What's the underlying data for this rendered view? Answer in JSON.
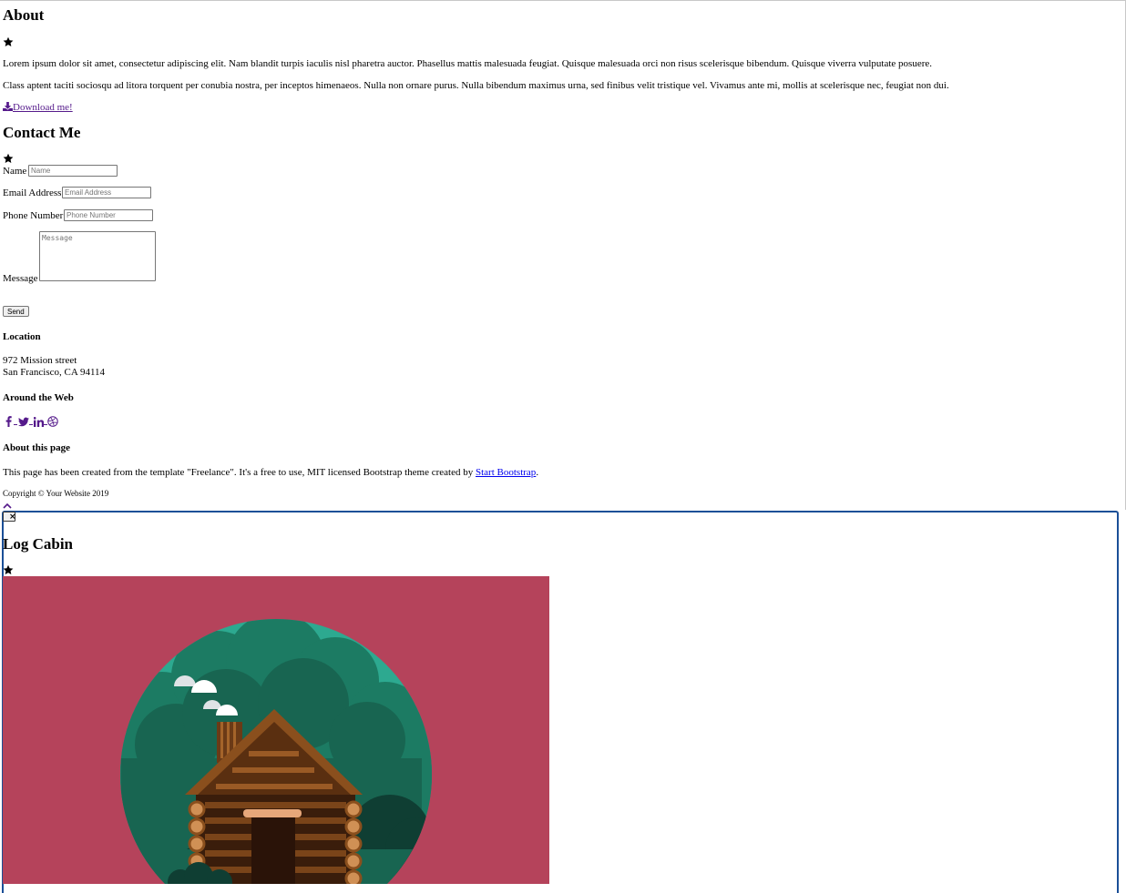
{
  "about": {
    "title": "About",
    "paragraph1": "Lorem ipsum dolor sit amet, consectetur adipiscing elit. Nam blandit turpis iaculis nisl pharetra auctor. Phasellus mattis malesuada feugiat. Quisque malesuada orci non risus scelerisque bibendum. Quisque viverra vulputate posuere.",
    "paragraph2": "Class aptent taciti sociosqu ad litora torquent per conubia nostra, per inceptos himenaeos. Nulla non ornare purus. Nulla bibendum maximus urna, sed finibus velit tristique vel. Vivamus ante mi, mollis at scelerisque nec, feugiat non dui.",
    "download_label": "Download me!",
    "icon": "star-icon"
  },
  "contact": {
    "title": "Contact Me",
    "name_label": "Name",
    "name_placeholder": "Name",
    "email_label": "Email Address",
    "email_placeholder": "Email Address",
    "phone_label": "Phone Number",
    "phone_placeholder": "Phone Number",
    "message_label": "Message",
    "message_placeholder": "Message",
    "send_label": "Send"
  },
  "footer": {
    "location_title": "Location",
    "address_line1": "972 Mission street",
    "address_line2": "San Francisco, CA 94114",
    "web_title": "Around the Web",
    "social_icons": [
      "facebook-icon",
      "twitter-icon",
      "linkedin-icon",
      "dribbble-icon"
    ],
    "about_title": "About this page",
    "about_text": "This page has been created from the template \"Freelance\". It's a free to use, MIT licensed Bootstrap theme created by",
    "about_link": "Start Bootstrap",
    "about_suffix": ".",
    "copyright": "Copyright © Your Website 2019"
  },
  "modal": {
    "close_label": "×",
    "title": "Log Cabin",
    "image_background": "#b5435b",
    "accent_teal": "#2da990",
    "border_color": "#1a4f97"
  },
  "colors": {
    "link_visited": "#551a8b",
    "link": "#0000ee"
  }
}
